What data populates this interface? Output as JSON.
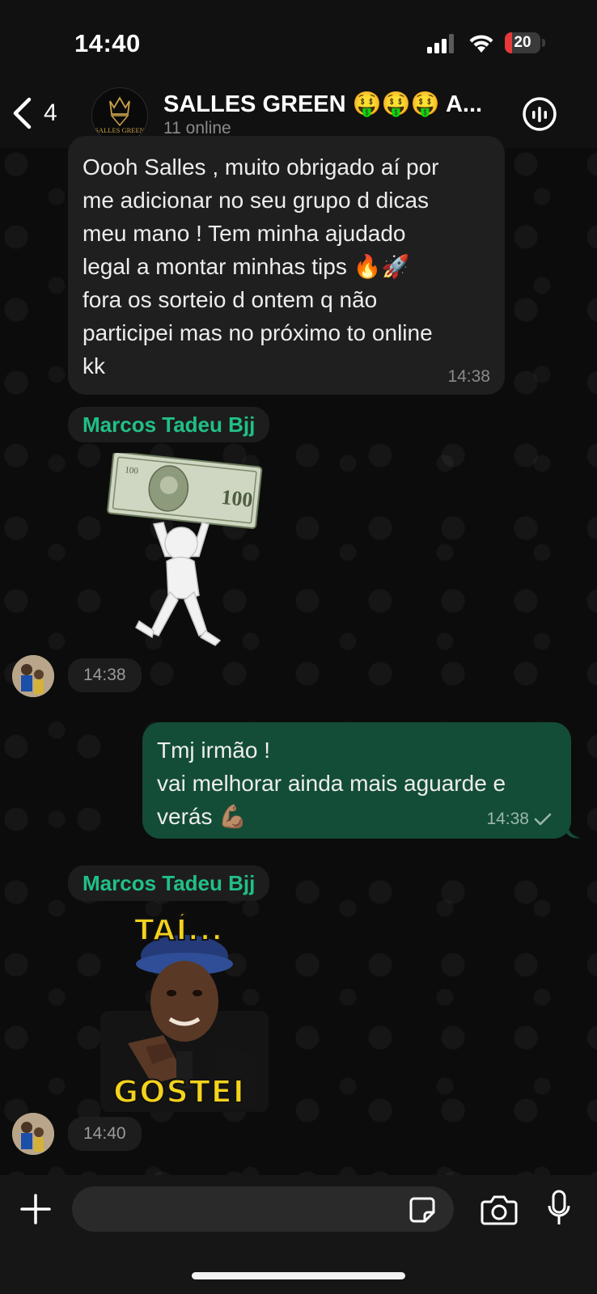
{
  "status_bar": {
    "time": "14:40",
    "battery": "20",
    "battery_level": 0.2
  },
  "header": {
    "back_count": "4",
    "group_name": "SALLES GREEN 🤑🤑🤑 A...",
    "group_logo_text": "SALLES GREEN",
    "online_status": "11 online"
  },
  "messages": [
    {
      "type": "incoming-text",
      "text": "Oooh Salles , muito obrigado aí por\nme adicionar no seu grupo d dicas\nmeu mano ! Tem minha ajudado\nlegal a montar minhas tips 🔥🚀\nfora os sorteio d ontem q não\nparticipei mas no próximo to online\nkk",
      "time": "14:38"
    },
    {
      "type": "incoming-sticker",
      "sender": "Marcos Tadeu Bjj",
      "sticker": "money-sticker",
      "time": "14:38"
    },
    {
      "type": "outgoing-text",
      "text": "Tmj irmão  !\nvai melhorar ainda mais aguarde e\nverás 💪🏽",
      "time": "14:38"
    },
    {
      "type": "incoming-sticker",
      "sender": "Marcos Tadeu Bjj",
      "sticker": "tai-gostei-sticker",
      "sticker_top": "TAÍ...",
      "sticker_bottom": "GOSTEI",
      "time": "14:40"
    }
  ],
  "composer": {
    "placeholder": ""
  },
  "colors": {
    "accent": "#21c087",
    "outgoing_bubble": "#134d37",
    "incoming_bubble": "#1f1f1f"
  }
}
